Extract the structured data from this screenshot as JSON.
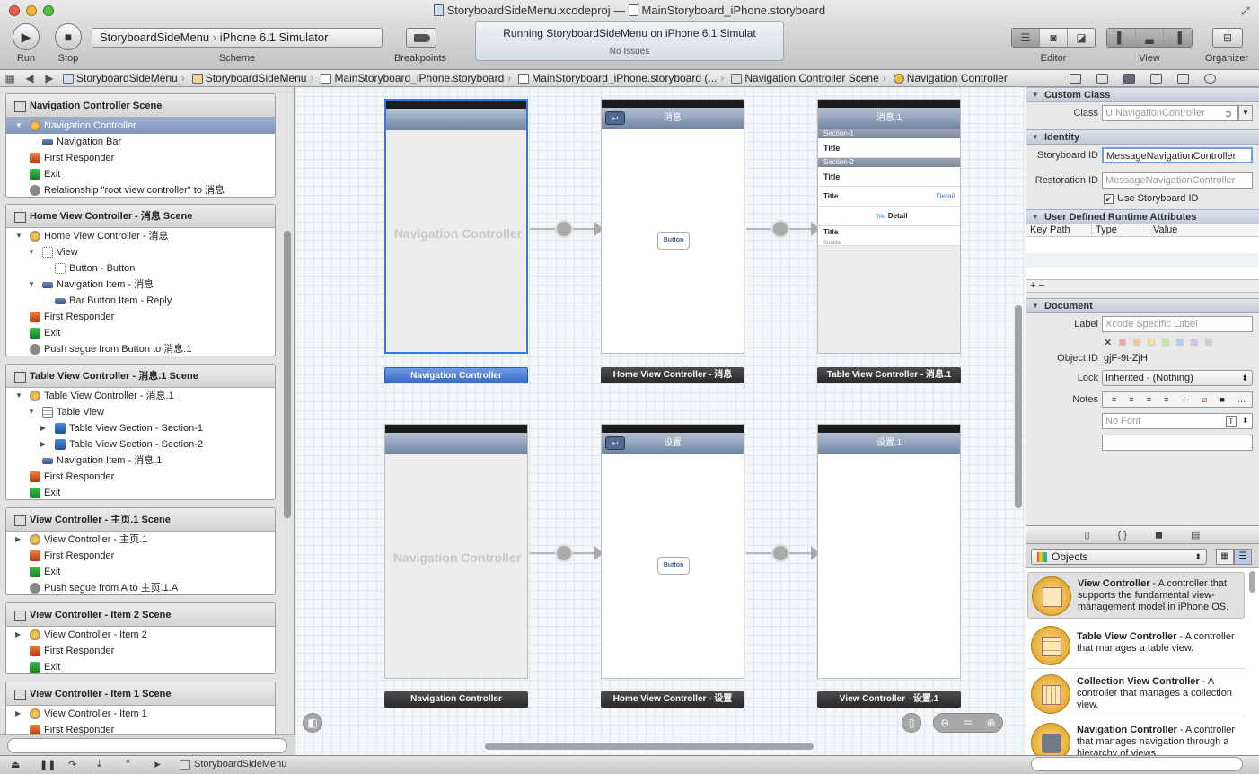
{
  "window": {
    "title_project": "StoryboardSideMenu.xcodeproj",
    "title_sep": "—",
    "title_file": "MainStoryboard_iPhone.storyboard"
  },
  "toolbar": {
    "run_label": "Run",
    "stop_label": "Stop",
    "scheme_target": "StoryboardSideMenu",
    "scheme_sep": "›",
    "scheme_dest": "iPhone 6.1 Simulator",
    "scheme_label": "Scheme",
    "breakpoints_label": "Breakpoints",
    "status_main": "Running StoryboardSideMenu on iPhone 6.1 Simulat",
    "status_sub": "No Issues",
    "editor_label": "Editor",
    "view_label": "View",
    "organizer_label": "Organizer"
  },
  "jumpbar": [
    "StoryboardSideMenu",
    "StoryboardSideMenu",
    "MainStoryboard_iPhone.storyboard",
    "MainStoryboard_iPhone.storyboard (...",
    "Navigation Controller Scene",
    "Navigation Controller"
  ],
  "outline": {
    "s1": {
      "title": "Navigation Controller Scene",
      "rows": [
        "Navigation Controller",
        "Navigation Bar",
        "First Responder",
        "Exit",
        "Relationship \"root view controller\" to 消息"
      ]
    },
    "s2": {
      "title": "Home View Controller - 消息 Scene",
      "rows": [
        "Home View Controller - 消息",
        "View",
        "Button - Button",
        "Navigation Item - 消息",
        "Bar Button Item - Reply",
        "First Responder",
        "Exit",
        "Push segue from Button to 消息.1"
      ]
    },
    "s3": {
      "title": "Table View Controller - 消息.1 Scene",
      "rows": [
        "Table View Controller - 消息.1",
        "Table View",
        "Table View Section - Section-1",
        "Table View Section - Section-2",
        "Navigation Item - 消息.1",
        "First Responder",
        "Exit"
      ]
    },
    "s4": {
      "title": "View Controller - 主页.1 Scene",
      "rows": [
        "View Controller - 主页.1",
        "First Responder",
        "Exit",
        "Push segue from A to 主页.1.A"
      ]
    },
    "s5": {
      "title": "View Controller - Item 2 Scene",
      "rows": [
        "View Controller - Item 2",
        "First Responder",
        "Exit"
      ]
    },
    "s6": {
      "title": "View Controller - Item 1 Scene",
      "rows": [
        "View Controller - Item 1",
        "First Responder"
      ]
    }
  },
  "canvas": {
    "nav_placeholder": "Navigation Controller",
    "title_msg": "消息",
    "title_msg1": "消息.1",
    "title_set": "设置",
    "title_set1": "设置.1",
    "button": "Button",
    "section1": "Section-1",
    "section2": "Section-2",
    "cell_title": "Title",
    "cell_detail": "Detail",
    "cell_subtitle": "Subtitle",
    "labels": [
      "Navigation Controller",
      "Home View Controller - 消息",
      "Table View Controller - 消息.1",
      "Navigation Controller",
      "Home View Controller - 设置",
      "View Controller - 设置.1"
    ]
  },
  "inspector": {
    "custom_class_hd": "Custom Class",
    "class_label": "Class",
    "class_placeholder": "UINavigationController",
    "identity_hd": "Identity",
    "storyboard_id_label": "Storyboard ID",
    "storyboard_id_value": "MessageNavigationController",
    "restoration_id_label": "Restoration ID",
    "restoration_id_placeholder": "MessageNavigationController",
    "use_storyboard_id": "Use Storyboard ID",
    "udra_hd": "User Defined Runtime Attributes",
    "col_keypath": "Key Path",
    "col_type": "Type",
    "col_value": "Value",
    "document_hd": "Document",
    "label_label": "Label",
    "label_placeholder": "Xcode Specific Label",
    "object_id_label": "Object ID",
    "object_id_value": "gjF-9t-ZjH",
    "lock_label": "Lock",
    "lock_value": "Inherited - (Nothing)",
    "notes_label": "Notes",
    "font_placeholder": "No Font"
  },
  "library": {
    "selector": "Objects",
    "items": [
      {
        "name": "View Controller",
        "desc": " - A controller that supports the fundamental view-management model in iPhone OS."
      },
      {
        "name": "Table View Controller",
        "desc": " - A controller that manages a table view."
      },
      {
        "name": "Collection View Controller",
        "desc": " - A controller that manages a collection view."
      },
      {
        "name": "Navigation Controller",
        "desc": " - A controller that manages navigation through a hierarchy of views."
      }
    ]
  },
  "bottombar": {
    "target": "StoryboardSideMenu"
  },
  "colors": {
    "selection": "#3c78d8",
    "nav_bar": "#6d84a2",
    "first_responder": "#d04a1e",
    "exit": "#2aa33a"
  }
}
